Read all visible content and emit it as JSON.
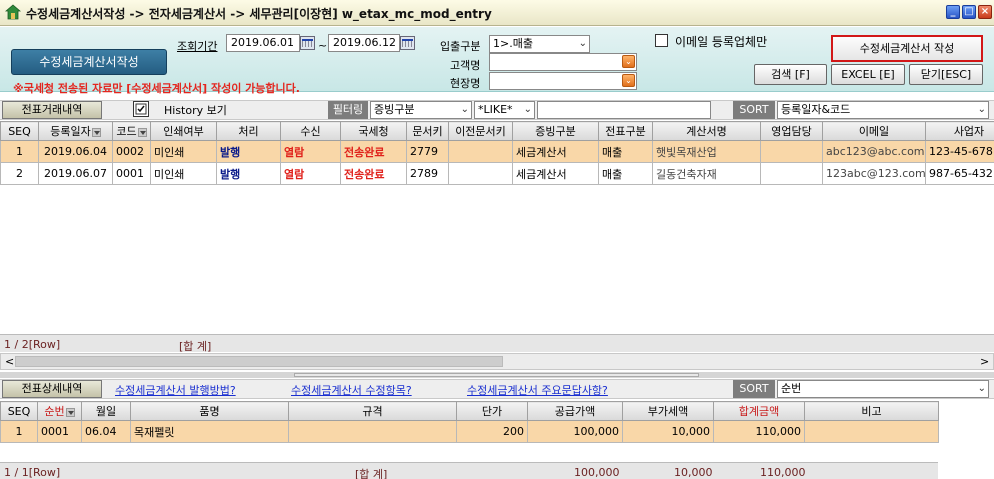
{
  "window": {
    "title": "수정세금계산서작성 -> 전자세금계산서 -> 세무관리[이장현] w_etax_mc_mod_entry",
    "controls": [
      "_",
      "□",
      "×"
    ]
  },
  "top": {
    "big_button": "수정세금계산서작성",
    "notice": "※국세청 전송된 자료만 [수정세금계산서] 작성이 가능합니다.",
    "period_label": "조회기간",
    "date_from": "2019.06.01",
    "date_sep": "~",
    "date_to": "2019.06.12",
    "inout_label": "입출구분",
    "inout_value": "1>.매출",
    "customer_label": "고객명",
    "customer_value": "",
    "site_label": "현장명",
    "site_value": "",
    "email_check_label": "이메일 등록업체만",
    "create_button": "수정세금계산서 작성",
    "search_button": "검색 [F]",
    "excel_button": "EXCEL [E]",
    "close_button": "닫기[ESC]"
  },
  "sec1": {
    "tab": "전표거래내역",
    "history_label": "History 보기",
    "filter_label": "필터링",
    "filter_field": "증빙구분",
    "filter_op": "*LIKE*",
    "filter_value": "",
    "sort_label": "SORT",
    "sort_value": "등록일자&코드"
  },
  "grid1": {
    "columns": [
      "SEQ",
      "등록일자",
      "코드",
      "인쇄여부",
      "처리",
      "수신",
      "국세청",
      "문서키",
      "이전문서키",
      "증빙구분",
      "전표구분",
      "계산서명",
      "영업담당",
      "이메일",
      "사업자"
    ],
    "rows": [
      [
        "1",
        "2019.06.04",
        "0002",
        "미인쇄",
        "발행",
        "열람",
        "전송완료",
        "2779",
        "",
        "세금계산서",
        "매출",
        "햇빛목재산업",
        "",
        "abc123@abc.com",
        "123-45-678"
      ],
      [
        "2",
        "2019.06.07",
        "0001",
        "미인쇄",
        "발행",
        "열람",
        "전송완료",
        "2789",
        "",
        "세금계산서",
        "매출",
        "길동건축자재",
        "",
        "123abc@123.com",
        "987-65-432"
      ]
    ],
    "footer_count": "1 / 2[Row]",
    "footer_total": "[합   계]"
  },
  "sec2": {
    "tab": "전표상세내역",
    "link1": "수정세금계산서 발행방법?",
    "link2": "수정세금계산서 수정항목?",
    "link3": "수정세금계산서 주요문답사항?",
    "sort_label": "SORT",
    "sort_value": "순번"
  },
  "grid2": {
    "columns": [
      "SEQ",
      "순번",
      "월일",
      "품명",
      "규격",
      "단가",
      "공급가액",
      "부가세액",
      "합계금액",
      "비고"
    ],
    "rows": [
      [
        "1",
        "0001",
        "06.04",
        "목재펠릿",
        "",
        "200",
        "100,000",
        "10,000",
        "110,000",
        ""
      ]
    ],
    "footer_count": "1 / 1[Row]",
    "footer_total": "[합   계]",
    "footer_supply": "100,000",
    "footer_vat": "10,000",
    "footer_sum": "110,000"
  },
  "colors": {
    "selected_row": "#f9d7a8",
    "top_panel": "#d3ecec",
    "accent_red": "#e0201a",
    "link_blue": "#1a2fd0"
  }
}
